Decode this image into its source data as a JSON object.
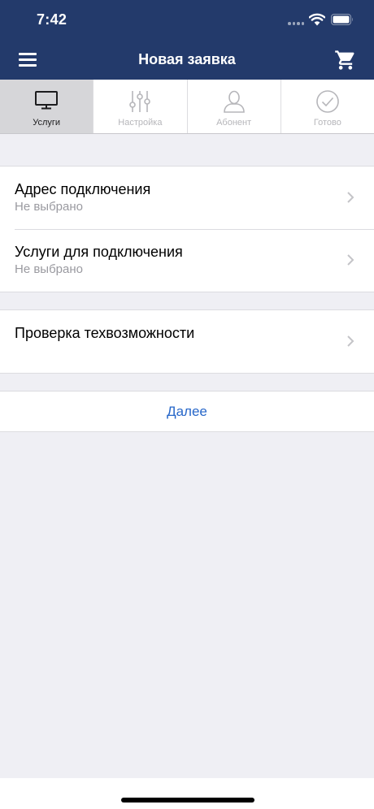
{
  "status_bar": {
    "time": "7:42"
  },
  "nav": {
    "title": "Новая заявка",
    "left_icon": "menu-icon",
    "right_icon": "cart-icon"
  },
  "tabs": [
    {
      "label": "Услуги",
      "icon": "monitor-icon",
      "active": true
    },
    {
      "label": "Настройка",
      "icon": "sliders-icon",
      "active": false
    },
    {
      "label": "Абонент",
      "icon": "person-icon",
      "active": false
    },
    {
      "label": "Готово",
      "icon": "check-circle-icon",
      "active": false
    }
  ],
  "groups": {
    "connection": {
      "address_title": "Адрес подключения",
      "address_value": "Не выбрано",
      "services_title": "Услуги для подключения",
      "services_value": "Не выбрано"
    },
    "check": {
      "title": "Проверка техвозможности"
    }
  },
  "actions": {
    "next_label": "Далее"
  },
  "colors": {
    "header_bg": "#233a6b",
    "page_bg": "#efeff4",
    "link": "#2767c9",
    "active_tab_bg": "#d6d6d9"
  }
}
